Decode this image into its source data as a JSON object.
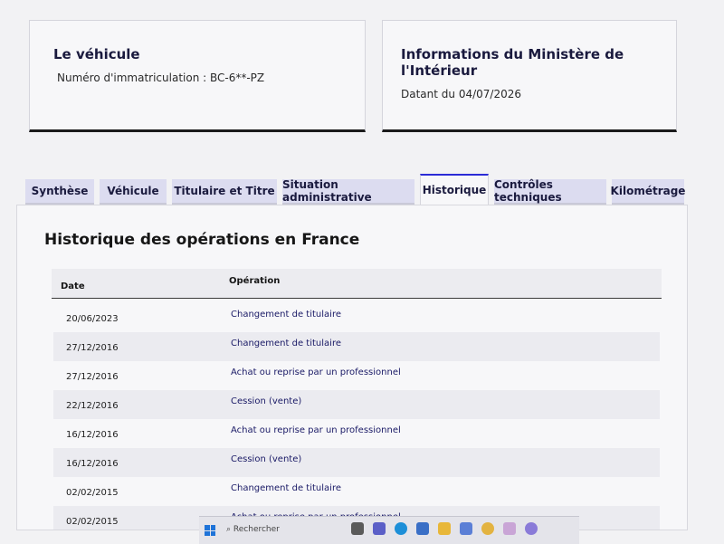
{
  "vehicle_card": {
    "title": "Le véhicule",
    "plate_line": "Numéro d'immatriculation : BC-6**-PZ"
  },
  "ministry_card": {
    "title": "Informations du Ministère de l'Intérieur",
    "date_line": "Datant du 04/07/2026"
  },
  "tabs": [
    {
      "label": "Synthèse"
    },
    {
      "label": "Véhicule"
    },
    {
      "label": "Titulaire et Titre"
    },
    {
      "label": "Situation administrative"
    },
    {
      "label": "Historique",
      "active": true
    },
    {
      "label": "Contrôles techniques"
    },
    {
      "label": "Kilométrage"
    }
  ],
  "history": {
    "title": "Historique des opérations en France",
    "columns": {
      "date": "Date",
      "operation": "Opération"
    },
    "rows": [
      {
        "date": "20/06/2023",
        "operation": "Changement de titulaire"
      },
      {
        "date": "27/12/2016",
        "operation": "Changement de titulaire"
      },
      {
        "date": "27/12/2016",
        "operation": "Achat ou reprise par un professionnel"
      },
      {
        "date": "22/12/2016",
        "operation": "Cession (vente)"
      },
      {
        "date": "16/12/2016",
        "operation": "Achat ou reprise par un professionnel"
      },
      {
        "date": "16/12/2016",
        "operation": "Cession (vente)"
      },
      {
        "date": "02/02/2015",
        "operation": "Changement de titulaire"
      },
      {
        "date": "02/02/2015",
        "operation": "Achat ou reprise par un professionnel"
      }
    ]
  },
  "taskbar": {
    "search_placeholder": "Rechercher",
    "icons": [
      "windows-icon",
      "search-icon",
      "file-explorer-icon",
      "teams-icon",
      "edge-icon",
      "store-icon",
      "folder-icon",
      "app-icon",
      "chrome-icon",
      "app-icon",
      "app-icon"
    ]
  },
  "colors": {
    "accent": "#2b2bd6",
    "tab_bg": "#dcdcf0",
    "title_blue": "#1a1a3e"
  }
}
